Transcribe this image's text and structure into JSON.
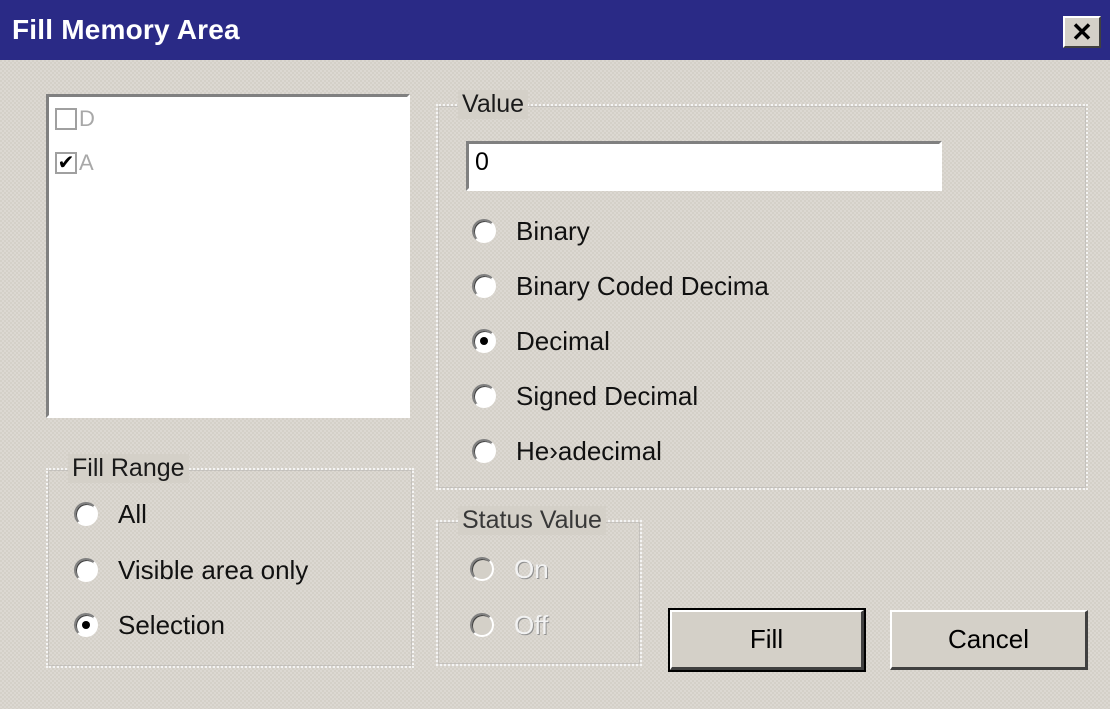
{
  "window": {
    "title": "Fill Memory Area",
    "close_label": "✕"
  },
  "listbox": {
    "items": [
      {
        "label": "D",
        "checked": false,
        "mark": ""
      },
      {
        "label": "A",
        "checked": true,
        "mark": "✔"
      }
    ]
  },
  "value_group": {
    "legend": "Value",
    "input_value": "0",
    "formats": [
      {
        "label": "Binary",
        "checked": false
      },
      {
        "label": "Binary Coded Decima",
        "checked": false
      },
      {
        "label": "Decimal",
        "checked": true
      },
      {
        "label": "Signed Decimal",
        "checked": false
      },
      {
        "label": "He›adecimal",
        "checked": false
      }
    ]
  },
  "fill_range": {
    "legend": "Fill Range",
    "options": [
      {
        "label": "All",
        "checked": false
      },
      {
        "label": "Visible area only",
        "checked": false
      },
      {
        "label": "Selection",
        "checked": true
      }
    ]
  },
  "status_value": {
    "legend": "Status Value",
    "options": [
      {
        "label": "On",
        "checked": false,
        "disabled": true
      },
      {
        "label": "Off",
        "checked": false,
        "disabled": true
      }
    ]
  },
  "buttons": {
    "fill_label": "Fill",
    "cancel_label": "Cancel"
  }
}
